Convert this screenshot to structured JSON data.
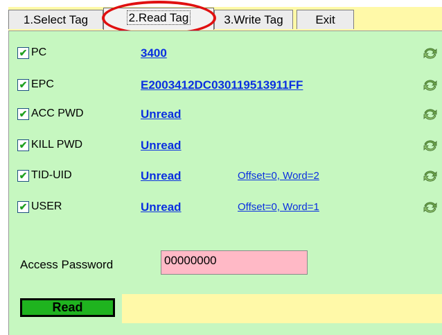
{
  "tabs": [
    {
      "label": "1.Select Tag",
      "active": false
    },
    {
      "label": "2.Read Tag",
      "active": true
    },
    {
      "label": "3.Write Tag",
      "active": false
    },
    {
      "label": "Exit",
      "active": false
    }
  ],
  "rows": [
    {
      "label": "PC",
      "checked": true,
      "value": "3400",
      "extra": ""
    },
    {
      "label": "EPC",
      "checked": true,
      "value": "E2003412DC030119513911FF",
      "extra": ""
    },
    {
      "label": "ACC PWD",
      "checked": true,
      "value": "Unread",
      "extra": ""
    },
    {
      "label": "KILL PWD",
      "checked": true,
      "value": "Unread",
      "extra": ""
    },
    {
      "label": "TID-UID",
      "checked": true,
      "value": "Unread",
      "extra": "Offset=0, Word=2"
    },
    {
      "label": "USER",
      "checked": true,
      "value": "Unread",
      "extra": "Offset=0, Word=1"
    }
  ],
  "access_password": {
    "label": "Access Password",
    "value": "00000000"
  },
  "read_button": {
    "label": "Read"
  },
  "colors": {
    "panel_bg": "#c6f7c0",
    "tabstrip_bg": "#fff9a8",
    "link_blue": "#0a2fe0",
    "password_bg": "#ffb9c6",
    "button_green": "#1fb31f",
    "highlight_red": "#e01010"
  },
  "icons": {
    "row_action": "refresh-icon",
    "checkbox": "checkmark-icon"
  }
}
